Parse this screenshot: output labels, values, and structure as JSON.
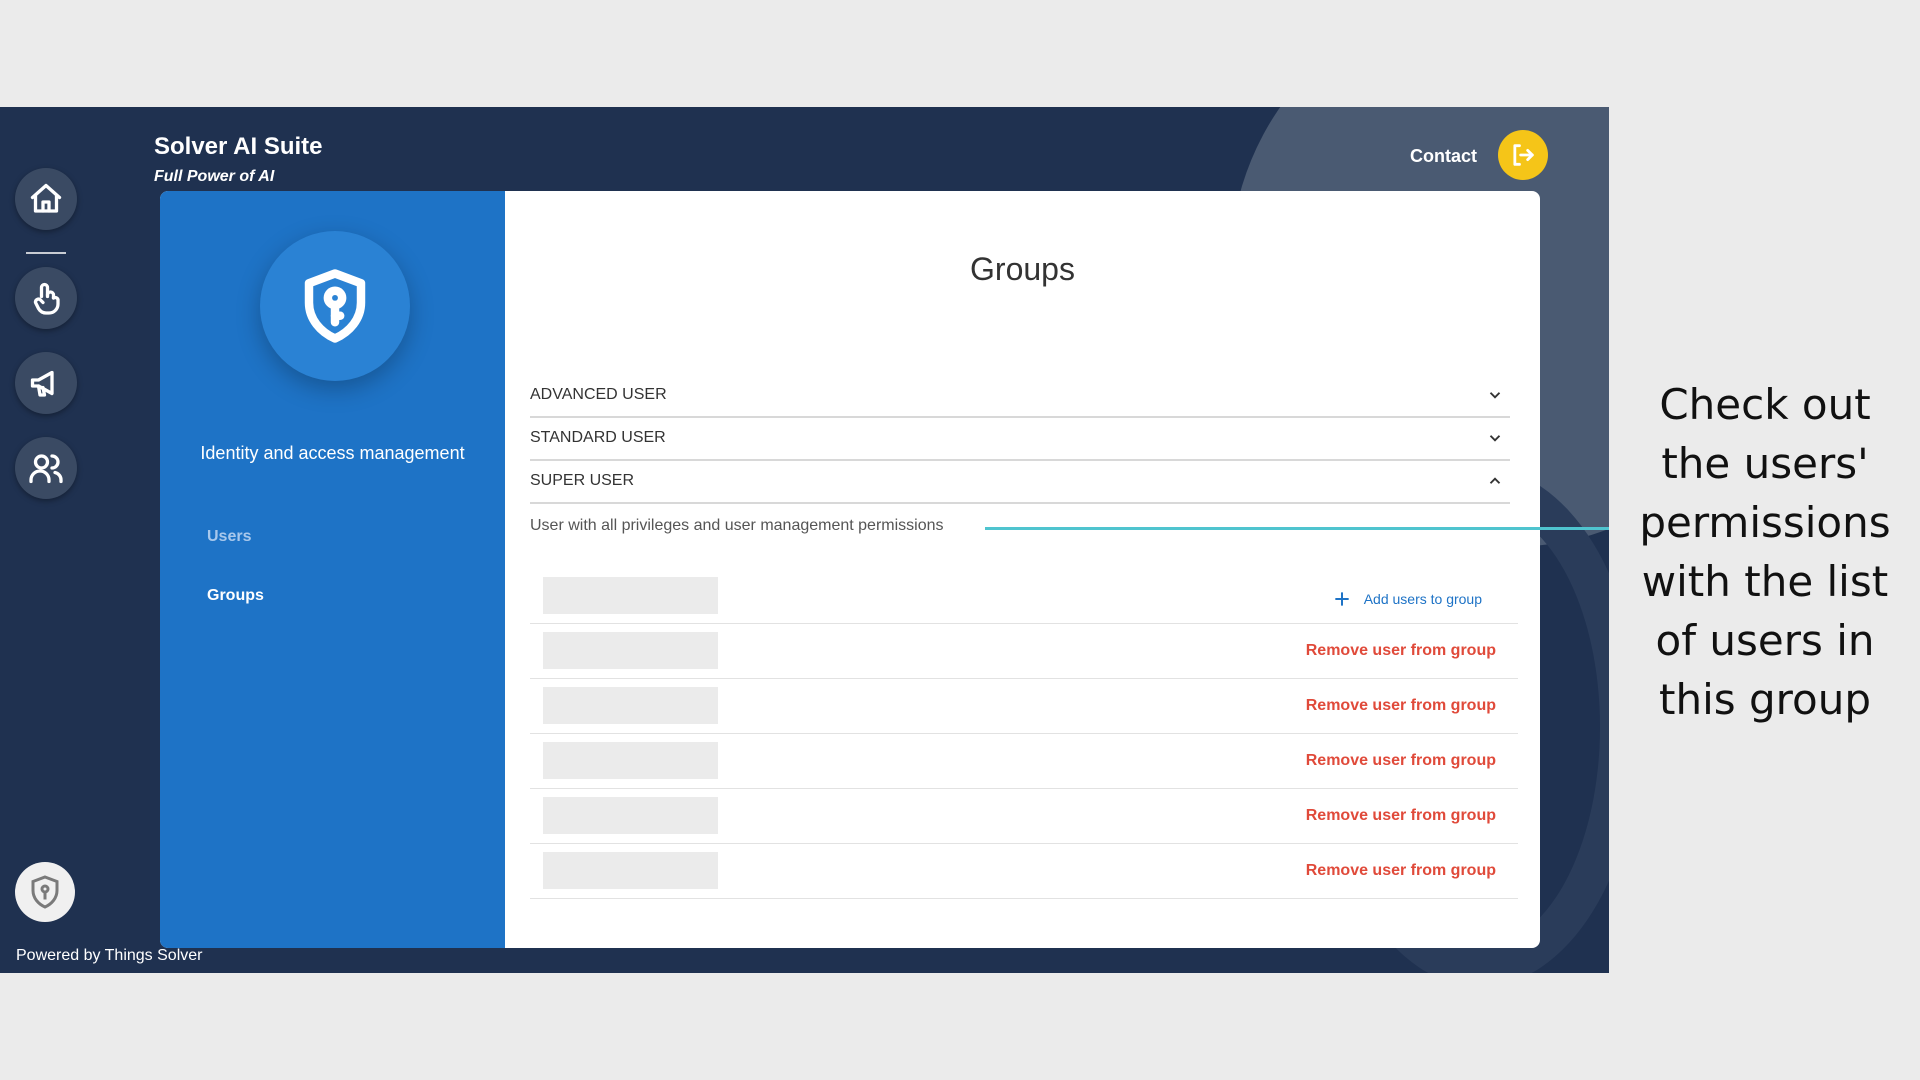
{
  "brand": {
    "title": "Solver AI Suite",
    "subtitle": "Full Power of AI"
  },
  "header": {
    "contact_label": "Contact"
  },
  "nav": {
    "items": [
      "home-icon",
      "touch-icon",
      "megaphone-icon",
      "users-icon"
    ],
    "bottom_icon": "shield-icon"
  },
  "footer": {
    "powered_by": "Powered by Things Solver"
  },
  "sidebar": {
    "title": "Identity and access management",
    "links": [
      {
        "label": "Users"
      },
      {
        "label": "Groups"
      }
    ]
  },
  "main": {
    "title": "Groups",
    "groups": [
      {
        "name": "ADVANCED USER",
        "expanded": false
      },
      {
        "name": "STANDARD USER",
        "expanded": false
      },
      {
        "name": "SUPER USER",
        "expanded": true
      }
    ],
    "description": "User with all privileges and user management permissions",
    "add_label": "Add users to group",
    "remove_label": "Remove user from group"
  },
  "callout": {
    "lines": [
      "Check out",
      "the users'",
      "permissions",
      "with the list",
      "of users in",
      "this group"
    ]
  },
  "colors": {
    "background_dark": "#1f3150",
    "sidebar_blue": "#1e73c6",
    "accent_yellow": "#f5c518",
    "remove_red": "#e04a3a",
    "pointer_teal": "#4fc4cf"
  }
}
